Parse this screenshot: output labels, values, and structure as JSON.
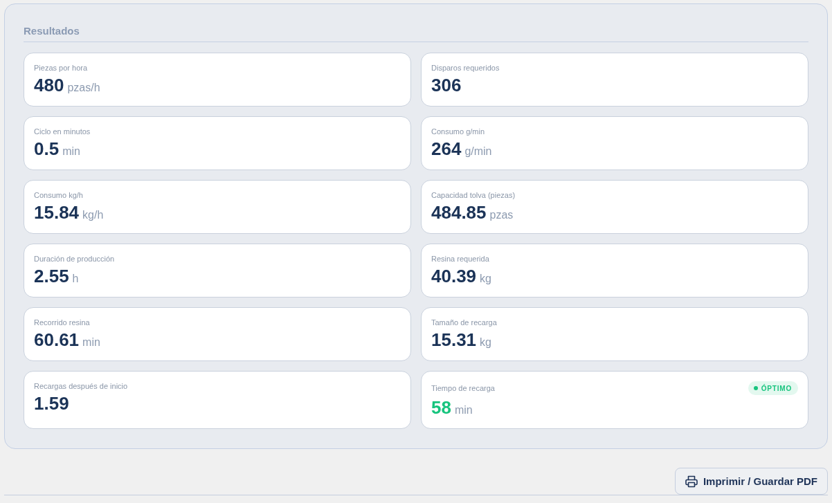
{
  "title": "Resultados",
  "cards": [
    {
      "label": "Piezas por hora",
      "value": "480",
      "unit": "pzas/h",
      "highlight": false
    },
    {
      "label": "Disparos requeridos",
      "value": "306",
      "highlight": false
    },
    {
      "label": "Ciclo en minutos",
      "value": "0.5",
      "unit": "min",
      "highlight": false
    },
    {
      "label": "Consumo g/min",
      "value": "264",
      "unit": "g/min",
      "highlight": false
    },
    {
      "label": "Consumo kg/h",
      "value": "15.84",
      "unit": "kg/h",
      "highlight": false
    },
    {
      "label": "Capacidad tolva (piezas)",
      "value": "484.85",
      "unit": "pzas",
      "highlight": false
    },
    {
      "label": "Duración de producción",
      "value": "2.55",
      "unit": "h",
      "highlight": false
    },
    {
      "label": "Resina requerida",
      "value": "40.39",
      "unit": "kg",
      "highlight": false
    },
    {
      "label": "Recorrido resina",
      "value": "60.61",
      "unit": "min",
      "highlight": false
    },
    {
      "label": "Tamaño de recarga",
      "value": "15.31",
      "unit": "kg",
      "highlight": false
    },
    {
      "label": "Recargas después de inicio",
      "value": "1.59",
      "highlight": false
    },
    {
      "label": "Tiempo de recarga",
      "value": "58",
      "unit": "min",
      "highlight": true,
      "badge": {
        "label": "ÓPTIMO",
        "color": "#17c47e"
      }
    }
  ],
  "print_button": {
    "label": "Imprimir / Guardar PDF"
  }
}
